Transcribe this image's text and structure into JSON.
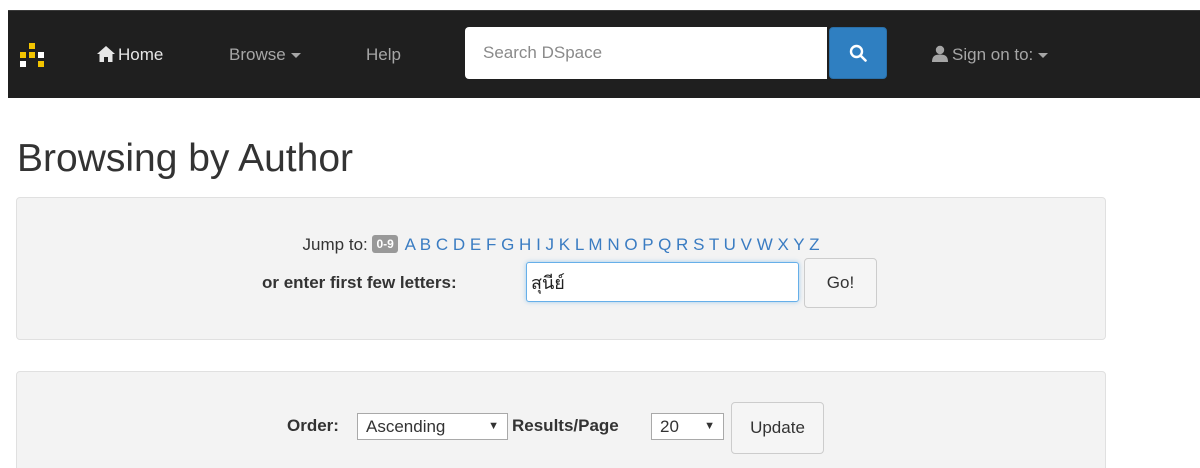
{
  "navbar": {
    "home_label": "Home",
    "browse_label": "Browse",
    "help_label": "Help",
    "search_placeholder": "Search DSpace",
    "sign_on_label": "Sign on to:"
  },
  "page": {
    "title": "Browsing by Author"
  },
  "jump": {
    "label": "Jump to:",
    "numeric_badge": "0-9",
    "letters": [
      "A",
      "B",
      "C",
      "D",
      "E",
      "F",
      "G",
      "H",
      "I",
      "J",
      "K",
      "L",
      "M",
      "N",
      "O",
      "P",
      "Q",
      "R",
      "S",
      "T",
      "U",
      "V",
      "W",
      "X",
      "Y",
      "Z"
    ],
    "first_letters_label": "or enter first few letters:",
    "first_letters_value": "สุนีย์",
    "go_label": "Go!"
  },
  "order": {
    "order_label": "Order:",
    "order_value": "Ascending",
    "results_label": "Results/Page",
    "results_value": "20",
    "update_label": "Update"
  },
  "colors": {
    "navbar_bg": "#1f1f1f",
    "accent": "#2f7fc1",
    "link": "#3a7cc2",
    "panel_bg": "#f3f3f3"
  }
}
